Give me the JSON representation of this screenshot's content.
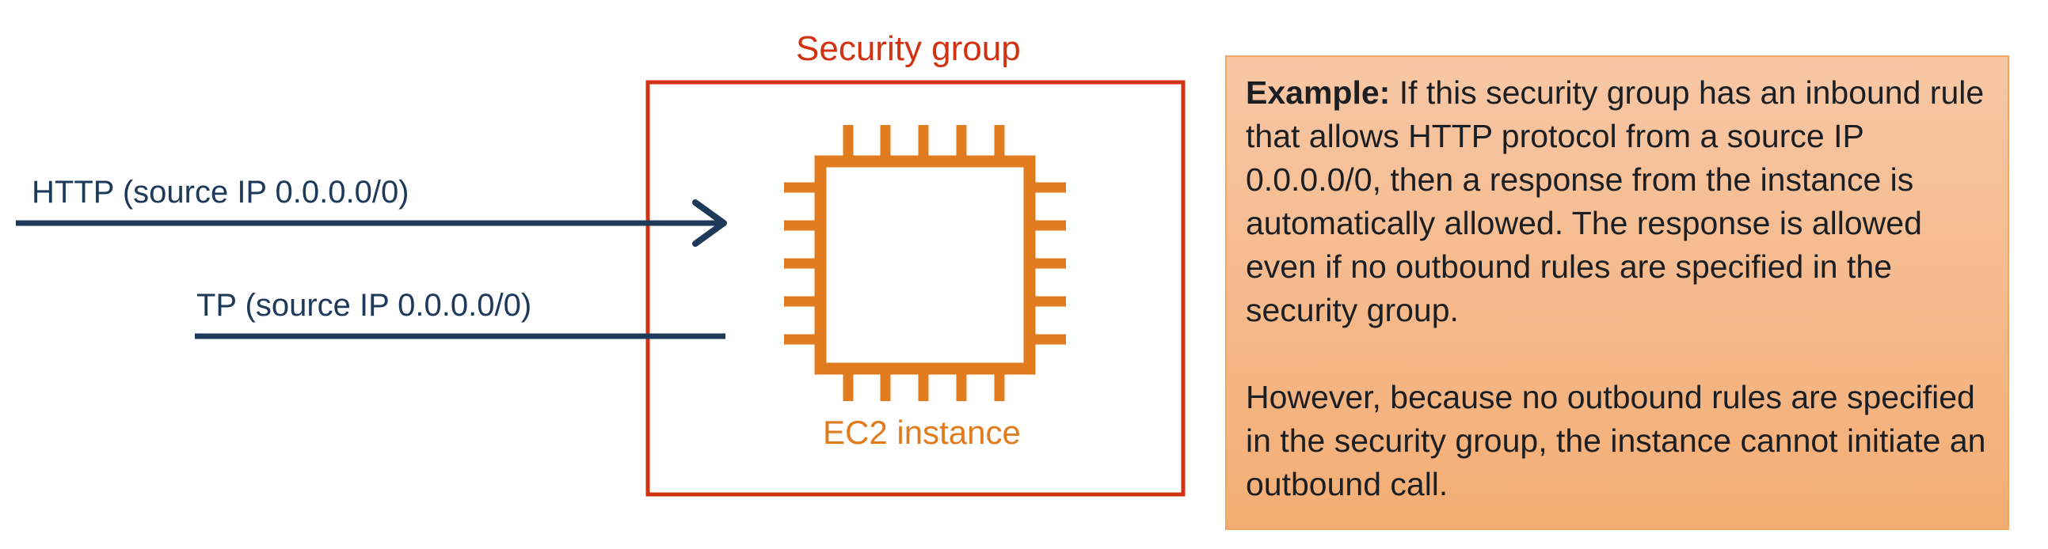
{
  "colors": {
    "security_group": "#d13212",
    "ec2_instance": "#e07b1e",
    "arrow": "#1e3a5a",
    "text": "#1b1e22",
    "example_bg_top": "#f7c7a5",
    "example_bg_bottom": "#f3ad74",
    "example_border": "#f0a860"
  },
  "icons": {
    "ec2": "chip-icon",
    "inbound": "arrow-right-icon"
  },
  "security_group": {
    "label": "Security group"
  },
  "ec2_instance": {
    "label": "EC2 instance"
  },
  "traffic": {
    "inbound_label": "HTTP (source IP 0.0.0.0/0)",
    "outbound_label": "TP  (source IP 0.0.0.0/0)"
  },
  "example": {
    "heading": "Example:",
    "paragraph1": "If this security group has an inbound rule that allows HTTP protocol from a source IP 0.0.0.0/0, then a response from the instance is automatically allowed. The response is allowed even if no outbound rules are specified in the security group.",
    "paragraph2": "However, because no outbound rules are specified in the security group, the instance cannot initiate an outbound call."
  }
}
